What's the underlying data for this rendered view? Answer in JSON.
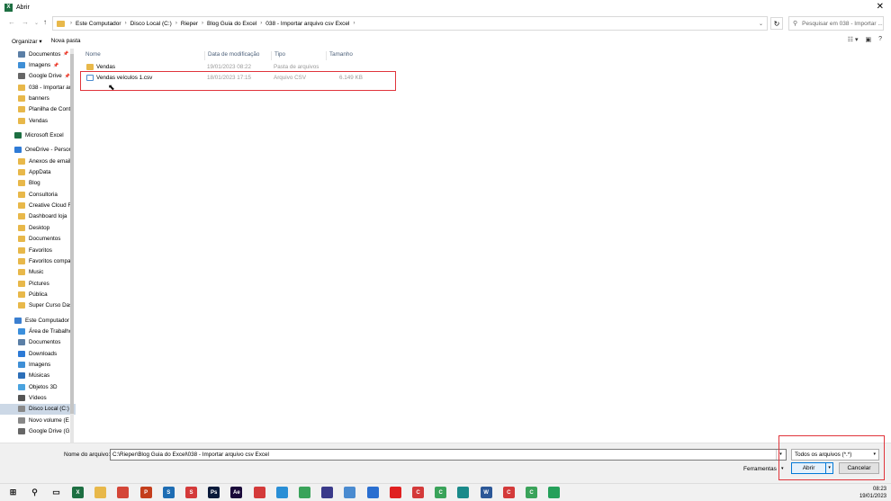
{
  "window": {
    "title": "Abrir",
    "app_icon": "excel-icon"
  },
  "address": {
    "crumbs": [
      "Este Computador",
      "Disco Local (C:)",
      "Rieper",
      "Blog Guia do Excel",
      "038 - Importar arquivo csv Excel"
    ],
    "search_placeholder": "Pesquisar em 038 - Importar ..."
  },
  "toolbar": {
    "organize": "Organizar ▾",
    "new_folder": "Nova pasta"
  },
  "sidebar": {
    "items": [
      {
        "label": "Documentos",
        "icon": "documents-icon",
        "color": "#5b7fa6",
        "pin": true
      },
      {
        "label": "Imagens",
        "icon": "images-icon",
        "color": "#3f8fd6",
        "pin": true
      },
      {
        "label": "Google Drive",
        "icon": "drive-icon",
        "color": "#666666",
        "pin": true
      },
      {
        "label": "038 - Importar ar",
        "icon": "folder-icon",
        "color": "#e8b84a",
        "pin": false
      },
      {
        "label": "banners",
        "icon": "folder-icon",
        "color": "#e8b84a",
        "pin": false
      },
      {
        "label": "Planilha de Cont",
        "icon": "shared-folder-icon",
        "color": "#e8b84a",
        "pin": false
      },
      {
        "label": "Vendas",
        "icon": "shared-folder-icon",
        "color": "#e8b84a",
        "pin": false
      },
      {
        "label": "Microsoft Excel",
        "icon": "excel-icon",
        "color": "#1d6f42",
        "pin": false,
        "gap": true
      },
      {
        "label": "OneDrive - Persor",
        "icon": "onedrive-icon",
        "color": "#2f7bd6",
        "pin": false,
        "gap": true
      },
      {
        "label": "Anexos de email",
        "icon": "folder-icon",
        "color": "#e8b84a",
        "pin": false
      },
      {
        "label": "AppData",
        "icon": "folder-icon",
        "color": "#e8b84a",
        "pin": false
      },
      {
        "label": "Blog",
        "icon": "folder-icon",
        "color": "#e8b84a",
        "pin": false
      },
      {
        "label": "Consultoria",
        "icon": "folder-icon",
        "color": "#e8b84a",
        "pin": false
      },
      {
        "label": "Creative Cloud F",
        "icon": "folder-icon",
        "color": "#e8b84a",
        "pin": false
      },
      {
        "label": "Dashboard loja",
        "icon": "folder-icon",
        "color": "#e8b84a",
        "pin": false
      },
      {
        "label": "Desktop",
        "icon": "folder-icon",
        "color": "#e8b84a",
        "pin": false
      },
      {
        "label": "Documentos",
        "icon": "folder-icon",
        "color": "#e8b84a",
        "pin": false
      },
      {
        "label": "Favoritos",
        "icon": "folder-icon",
        "color": "#e8b84a",
        "pin": false
      },
      {
        "label": "Favoritos compa",
        "icon": "folder-icon",
        "color": "#e8b84a",
        "pin": false
      },
      {
        "label": "Music",
        "icon": "folder-icon",
        "color": "#e8b84a",
        "pin": false
      },
      {
        "label": "Pictures",
        "icon": "folder-icon",
        "color": "#e8b84a",
        "pin": false
      },
      {
        "label": "Pública",
        "icon": "folder-icon",
        "color": "#e8b84a",
        "pin": false
      },
      {
        "label": "Super Curso Das",
        "icon": "folder-icon",
        "color": "#e8b84a",
        "pin": false
      },
      {
        "label": "Este Computador",
        "icon": "computer-icon",
        "color": "#3b7fd0",
        "pin": false,
        "gap": true
      },
      {
        "label": "Área de Trabalho",
        "icon": "desktop-icon",
        "color": "#3b8fdc",
        "pin": false
      },
      {
        "label": "Documentos",
        "icon": "documents-icon",
        "color": "#5b7fa6",
        "pin": false
      },
      {
        "label": "Downloads",
        "icon": "downloads-icon",
        "color": "#2d7ad6",
        "pin": false
      },
      {
        "label": "Imagens",
        "icon": "images-icon",
        "color": "#3f8fd6",
        "pin": false
      },
      {
        "label": "Músicas",
        "icon": "music-icon",
        "color": "#2d6fb8",
        "pin": false
      },
      {
        "label": "Objetos 3D",
        "icon": "objects-3d-icon",
        "color": "#4aa3df",
        "pin": false
      },
      {
        "label": "Vídeos",
        "icon": "videos-icon",
        "color": "#555555",
        "pin": false
      },
      {
        "label": "Disco Local (C:)",
        "icon": "disk-icon",
        "color": "#888888",
        "pin": false,
        "selected": true
      },
      {
        "label": "Novo volume (E",
        "icon": "disk-icon",
        "color": "#888888",
        "pin": false
      },
      {
        "label": "Google Drive (G:",
        "icon": "drive-icon",
        "color": "#666666",
        "pin": false
      }
    ]
  },
  "file_list": {
    "columns": [
      "Nome",
      "Data de modificação",
      "Tipo",
      "Tamanho"
    ],
    "rows": [
      {
        "name": "Vendas",
        "date": "19/01/2023 08:22",
        "type": "Pasta de arquivos",
        "size": "",
        "icon": "shared-folder-icon",
        "color": "#e8b84a",
        "dim": true
      },
      {
        "name": "Vendas veículos 1.csv",
        "date": "18/01/2023 17:15",
        "type": "Arquivo CSV",
        "size": "6.149 KB",
        "icon": "csv-file-icon",
        "color": "#4a8bd0",
        "dim": true
      }
    ]
  },
  "bottom": {
    "filename_label": "Nome do arquivo:",
    "filename_value": "C:\\Rieper\\Blog Guia do Excel\\038 - Importar arquivo csv Excel",
    "filetype_value": "Todos os arquivos (*.*)",
    "tools_label": "Ferramentas",
    "open_label": "Abrir",
    "cancel_label": "Cancelar"
  },
  "taskbar": {
    "time": "08:23",
    "date": "19/01/2023",
    "icons": [
      {
        "name": "start-icon",
        "color": "#1a1a1a",
        "text": ""
      },
      {
        "name": "search-icon",
        "color": "#1a1a1a",
        "text": ""
      },
      {
        "name": "task-view-icon",
        "color": "#1a1a1a",
        "text": ""
      },
      {
        "name": "excel-icon",
        "color": "#1d6f42",
        "text": "X"
      },
      {
        "name": "file-explorer-icon",
        "color": "#e8b84a",
        "text": ""
      },
      {
        "name": "chrome-icon",
        "color": "#d44638",
        "text": ""
      },
      {
        "name": "powerpoint-icon",
        "color": "#c43e1c",
        "text": "P"
      },
      {
        "name": "sway-icon",
        "color": "#1e6db3",
        "text": "S"
      },
      {
        "name": "app-s-icon",
        "color": "#d43a3a",
        "text": "S"
      },
      {
        "name": "photoshop-icon",
        "color": "#0a1a3a",
        "text": "Ps"
      },
      {
        "name": "after-effects-icon",
        "color": "#1a0a3a",
        "text": "Ae"
      },
      {
        "name": "media-icon",
        "color": "#d43a3a",
        "text": ""
      },
      {
        "name": "app-blue-icon",
        "color": "#2a8fd6",
        "text": ""
      },
      {
        "name": "app-green-icon",
        "color": "#3aa35a",
        "text": ""
      },
      {
        "name": "headset-icon",
        "color": "#3a3a8a",
        "text": ""
      },
      {
        "name": "notepad-icon",
        "color": "#4a8bd0",
        "text": ""
      },
      {
        "name": "app-blue2-icon",
        "color": "#2a6fd0",
        "text": ""
      },
      {
        "name": "youtube-icon",
        "color": "#e02020",
        "text": ""
      },
      {
        "name": "app-red-icon",
        "color": "#d43a3a",
        "text": "C"
      },
      {
        "name": "app-green2-icon",
        "color": "#3aa35a",
        "text": "C"
      },
      {
        "name": "edge-icon",
        "color": "#1a8a8a",
        "text": ""
      },
      {
        "name": "word-icon",
        "color": "#2b5797",
        "text": "W"
      },
      {
        "name": "app-red2-icon",
        "color": "#d43a3a",
        "text": "C"
      },
      {
        "name": "app-green3-icon",
        "color": "#3aa35a",
        "text": "C"
      },
      {
        "name": "whatsapp-icon",
        "color": "#25a05a",
        "text": ""
      }
    ]
  }
}
